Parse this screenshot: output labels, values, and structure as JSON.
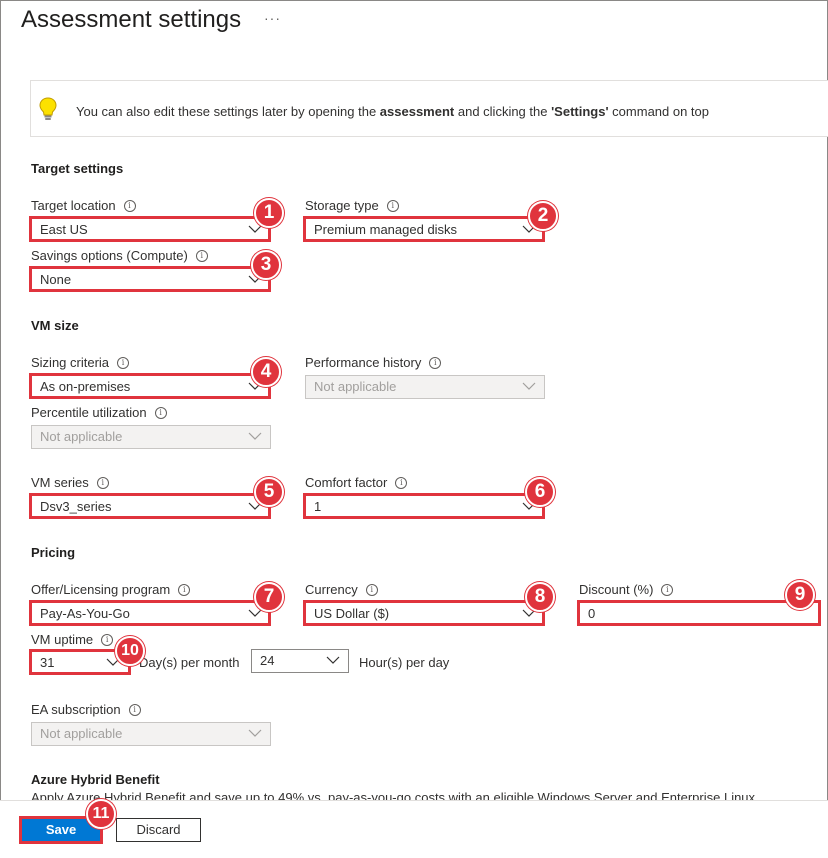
{
  "header": {
    "title": "Assessment settings",
    "more": "···"
  },
  "info": {
    "text_before": "You can also edit these settings later by opening the ",
    "bold1": "assessment",
    "text_middle": " and clicking the ",
    "bold2": "'Settings'",
    "text_after": " command on top"
  },
  "target": {
    "heading": "Target settings",
    "location_label": "Target location",
    "location_value": "East US",
    "storage_label": "Storage type",
    "storage_value": "Premium managed disks",
    "savings_label": "Savings options (Compute)",
    "savings_value": "None"
  },
  "vmsize": {
    "heading": "VM size",
    "sizing_label": "Sizing criteria",
    "sizing_value": "As on-premises",
    "perf_label": "Performance history",
    "perf_value": "Not applicable",
    "percentile_label": "Percentile utilization",
    "percentile_value": "Not applicable",
    "series_label": "VM series",
    "series_value": "Dsv3_series",
    "comfort_label": "Comfort factor",
    "comfort_value": "1"
  },
  "pricing": {
    "heading": "Pricing",
    "offer_label": "Offer/Licensing program",
    "offer_value": "Pay-As-You-Go",
    "currency_label": "Currency",
    "currency_value": "US Dollar ($)",
    "discount_label": "Discount (%)",
    "discount_value": "0",
    "uptime_label": "VM uptime",
    "days_value": "31",
    "days_unit": "Day(s) per month",
    "hours_value": "24",
    "hours_unit": "Hour(s) per day",
    "ea_label": "EA subscription",
    "ea_value": "Not applicable"
  },
  "hybrid": {
    "heading": "Azure Hybrid Benefit",
    "desc": "Apply Azure Hybrid Benefit and save up to 49% vs. pay-as-you-go costs with an eligible Windows Server and Enterprise Linux"
  },
  "footer": {
    "save_label": "Save",
    "discard_label": "Discard"
  },
  "badges": [
    "1",
    "2",
    "3",
    "4",
    "5",
    "6",
    "7",
    "8",
    "9",
    "10",
    "11"
  ],
  "colors": {
    "accent": "#0078d4",
    "highlight": "#e0343d"
  }
}
